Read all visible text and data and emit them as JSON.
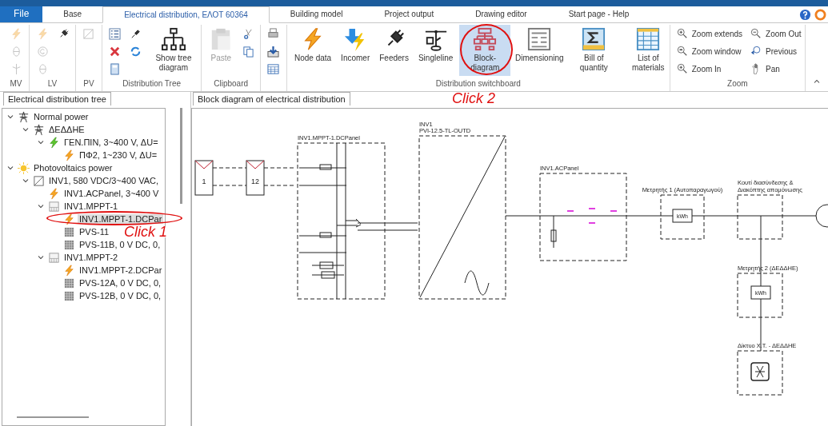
{
  "tabs": [
    {
      "label": "File",
      "kind": "file"
    },
    {
      "label": "Base",
      "kind": "tab",
      "selected": false
    },
    {
      "label": "Electrical distribution, ΕΛΟΤ 60364",
      "kind": "tab",
      "selected": true
    },
    {
      "label": "Building model",
      "kind": "tab",
      "selected": false
    },
    {
      "label": "Project output",
      "kind": "tab",
      "selected": false
    },
    {
      "label": "Drawing editor",
      "kind": "tab",
      "selected": false
    },
    {
      "label": "Start page - Help",
      "kind": "tab",
      "selected": false
    }
  ],
  "ribbon": {
    "groups": [
      {
        "label": "MV",
        "kind": "tools",
        "items": [
          {
            "kind": "bolt",
            "disabled": true
          },
          {
            "kind": "coil",
            "disabled": true
          },
          {
            "kind": "wind",
            "disabled": true
          }
        ]
      },
      {
        "label": "LV",
        "kind": "tools",
        "items": [
          {
            "kind": "bolt",
            "disabled": true
          },
          {
            "kind": "generator",
            "disabled": true
          },
          {
            "kind": "coil",
            "disabled": true
          },
          {
            "kind": "plug",
            "disabled": false
          }
        ]
      },
      {
        "label": "PV",
        "kind": "tools",
        "items": [
          {
            "kind": "inverter",
            "disabled": true
          }
        ]
      },
      {
        "label": "Distribution Tree",
        "kind": "tools",
        "items": [
          {
            "kind": "list",
            "disabled": false
          },
          {
            "kind": "cross",
            "disabled": false
          },
          {
            "kind": "calc",
            "disabled": false
          },
          {
            "kind": "cable",
            "disabled": false
          },
          {
            "kind": "refresh",
            "disabled": false
          },
          {
            "kind": "tree",
            "label": "Show tree diagram",
            "selected": false
          }
        ]
      },
      {
        "label": "Clipboard",
        "kind": "tools",
        "items": [
          {
            "kind": "paste",
            "label": "Paste",
            "selected": false,
            "disabled": true
          },
          {
            "kind": "scissors",
            "disabled": false
          },
          {
            "kind": "copy",
            "disabled": false
          }
        ]
      },
      {
        "kind": "tools",
        "items": [
          {
            "kind": "print",
            "disabled": false
          },
          {
            "kind": "download",
            "disabled": false
          },
          {
            "kind": "table",
            "disabled": false
          }
        ]
      },
      {
        "label": "Distribution switchboard",
        "kind": "tools",
        "items": [
          {
            "kind": "bolt",
            "label": "Node data",
            "selected": false
          },
          {
            "kind": "incomer",
            "label": "Incomer",
            "selected": false
          },
          {
            "kind": "plug",
            "label": "Feeders",
            "selected": false
          },
          {
            "kind": "singleline",
            "label": "Singleline",
            "selected": false
          },
          {
            "kind": "block",
            "label": "Block-diagram",
            "selected": true
          },
          {
            "kind": "dim",
            "label": "Dimensioning",
            "selected": false
          },
          {
            "kind": "sigma",
            "label": "Bill of quantity",
            "selected": false
          },
          {
            "kind": "grid",
            "label": "List of materials",
            "selected": false
          }
        ]
      },
      {
        "label": "Zoom",
        "kind": "zoom",
        "items": [
          {
            "kind": "zoomext",
            "label": "Zoom extends"
          },
          {
            "kind": "zoomwin",
            "label": "Zoom window"
          },
          {
            "kind": "zoomin",
            "label": "Zoom In"
          },
          {
            "kind": "zoomout",
            "label": "Zoom Out"
          },
          {
            "kind": "previous",
            "label": "Previous"
          },
          {
            "kind": "pan",
            "label": "Pan"
          }
        ]
      }
    ]
  },
  "tree_panel": {
    "title": "Electrical distribution tree",
    "items": [
      {
        "label": "Normal power",
        "kind": "tower",
        "expanded": true,
        "selected": false,
        "children": [
          {
            "label": "ΔΕΔΔΗΕ",
            "kind": "tower",
            "expanded": true,
            "selected": false,
            "children": [
              {
                "label": "ΓΕΝ.ΠΙΝ, 3~400 V, ΔU=",
                "kind": "incomer",
                "expanded": true,
                "selected": false,
                "children": [
                  {
                    "label": "ΠΦ2, 1~230 V, ΔU=",
                    "kind": "panel",
                    "selected": false
                  }
                ]
              }
            ]
          }
        ]
      },
      {
        "label": "Photovoltaics power",
        "kind": "sun",
        "expanded": true,
        "selected": false,
        "children": [
          {
            "label": "INV1, 580 VDC/3~400 VAC,",
            "kind": "inverter",
            "expanded": true,
            "selected": false,
            "children": [
              {
                "label": "INV1.ACPanel, 3~400 V",
                "kind": "panel",
                "selected": false
              },
              {
                "label": "INV1.MPPT-1",
                "kind": "pv",
                "expanded": true,
                "selected": false,
                "children": [
                  {
                    "label": "INV1.MPPT-1.DCPar",
                    "kind": "panel",
                    "selected": true
                  },
                  {
                    "label": "PVS-11",
                    "kind": "module",
                    "selected": false
                  },
                  {
                    "label": "PVS-11B, 0 V DC, 0,",
                    "kind": "module",
                    "selected": false
                  }
                ]
              },
              {
                "label": "INV1.MPPT-2",
                "kind": "pv",
                "expanded": true,
                "selected": false,
                "children": [
                  {
                    "label": "INV1.MPPT-2.DCPar",
                    "kind": "panel",
                    "selected": false
                  },
                  {
                    "label": "PVS-12A, 0 V DC, 0,",
                    "kind": "module",
                    "selected": false
                  },
                  {
                    "label": "PVS-12B, 0 V DC, 0,",
                    "kind": "module",
                    "selected": false
                  }
                ]
              }
            ]
          }
        ]
      }
    ]
  },
  "diagram_panel": {
    "title": "Block diagram of electrical distribution",
    "string_first": "1",
    "string_last": "12",
    "dc_panel": "INV1.MPPT-1.DCPanel",
    "inverter_name": "INV1",
    "inverter_model": "PVI-12.5-TL-OUTD",
    "ac_panel": "INV1.ACPanel",
    "meter_1": {
      "title": "Μετρητής 1 (Αυτοπαραγωγού)",
      "unit": "kWh"
    },
    "junction": [
      "Κουτί διασύνδεσης &",
      "Διακόπτης απομόνωσης"
    ],
    "meter_2": {
      "title": "Μετρητής 2 (ΔΕΔΔΗΕ)",
      "unit": "kWh"
    },
    "grid": "Δίκτυο Χ.Τ. - ΔΕΔΔΗΕ"
  },
  "annotations": [
    {
      "label": "Click 1"
    },
    {
      "label": "Click 2"
    }
  ]
}
